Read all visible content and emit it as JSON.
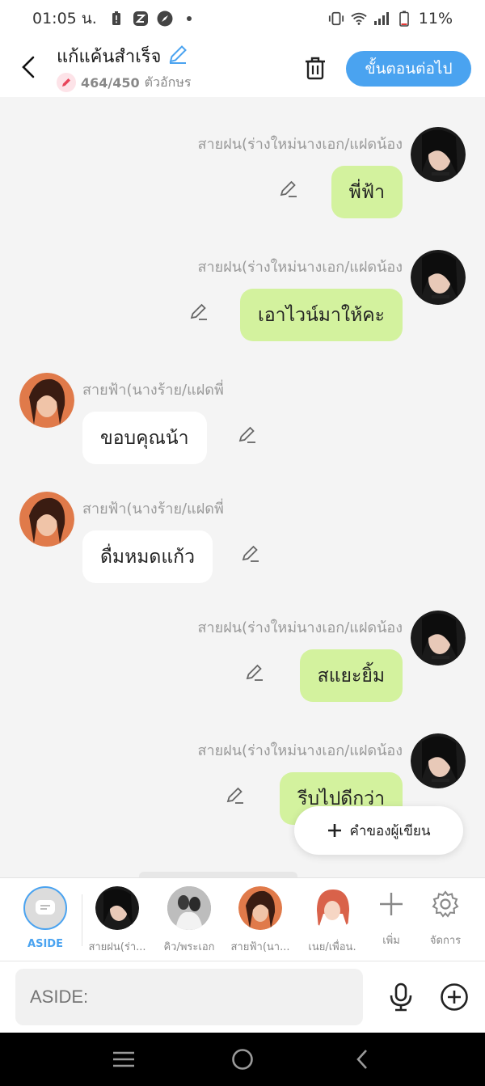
{
  "status_bar": {
    "time": "01:05 น.",
    "battery": "11%"
  },
  "header": {
    "title": "แก้แค้นสำเร็จ",
    "char_count": "464/450",
    "char_unit": "ตัวอักษร",
    "next_label": "ขั้นตอนต่อไป"
  },
  "messages": [
    {
      "side": "right",
      "sender": "สายฝน(ร่างใหม่นางเอก/แฝดน้อง",
      "text": "พี่ฟ้า"
    },
    {
      "side": "right",
      "sender": "สายฝน(ร่างใหม่นางเอก/แฝดน้อง",
      "text": "เอาไวน์มาให้คะ"
    },
    {
      "side": "left",
      "sender": "สายฟ้า(นางร้าย/แฝดพี่",
      "text": "ขอบคุณน้า"
    },
    {
      "side": "left",
      "sender": "สายฟ้า(นางร้าย/แฝดพี่",
      "text": "ดื่มหมดแก้ว"
    },
    {
      "side": "right",
      "sender": "สายฝน(ร่างใหม่นางเอก/แฝดน้อง",
      "text": "สแยะยิ้ม"
    },
    {
      "side": "right",
      "sender": "สายฝน(ร่างใหม่นางเอก/แฝดน้อง",
      "text": "รีบไปดีกว่า"
    }
  ],
  "author_button": "คำของผู้เขียน",
  "characters": {
    "aside_label": "ASIDE",
    "items": [
      {
        "label": "สายฝน(ร่า..."
      },
      {
        "label": "คิว/พระเอก"
      },
      {
        "label": "สายฟ้า(นา..."
      },
      {
        "label": "เนย/เพื่อน."
      }
    ],
    "add_label": "เพิ่ม",
    "manage_label": "จัดการ"
  },
  "input": {
    "placeholder": "ASIDE:"
  },
  "colors": {
    "accent": "#4aa3f0",
    "bubble_right": "#d3f29e",
    "bubble_left": "#ffffff",
    "background": "#f4f4f4"
  }
}
